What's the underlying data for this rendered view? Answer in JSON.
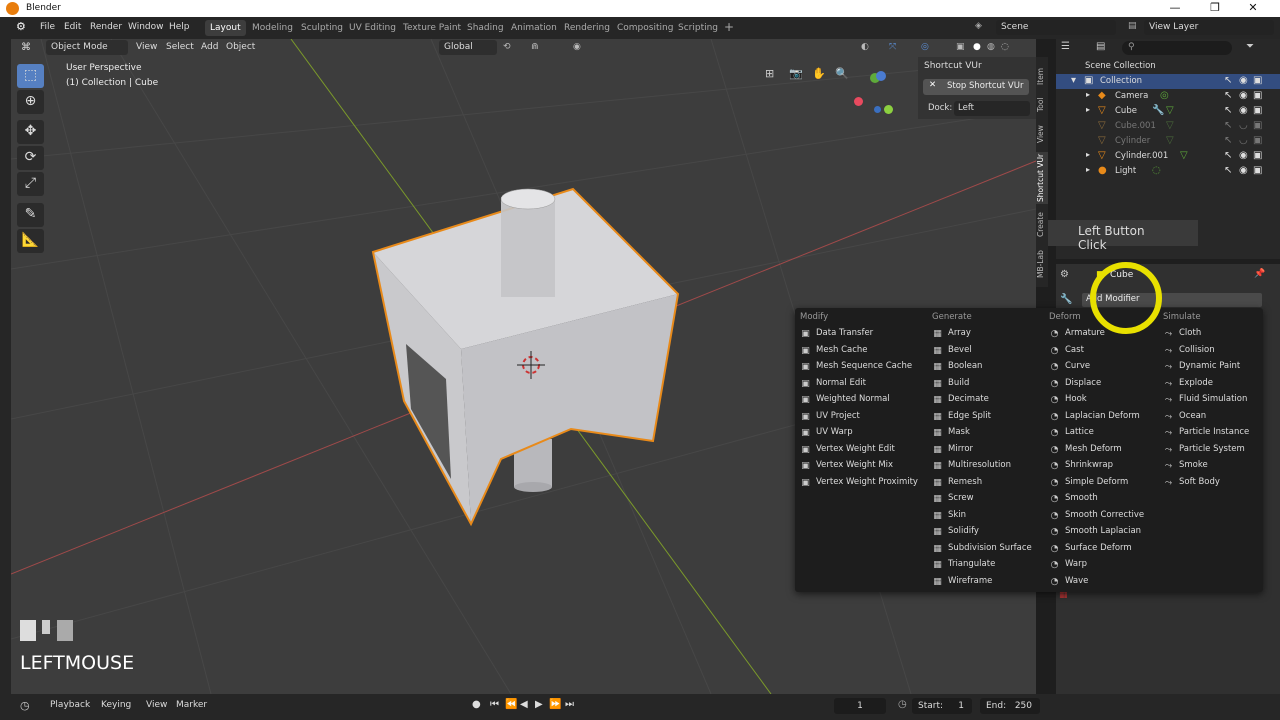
{
  "window": {
    "title": "Blender",
    "min_label": "—",
    "max_label": "❐",
    "close_label": "✕"
  },
  "menu": [
    "File",
    "Edit",
    "Render",
    "Window",
    "Help"
  ],
  "workspaces": [
    "Layout",
    "Modeling",
    "Sculpting",
    "UV Editing",
    "Texture Paint",
    "Shading",
    "Animation",
    "Rendering",
    "Compositing",
    "Scripting"
  ],
  "add_workspace": "+",
  "scene": {
    "label": "Scene",
    "view_layer": "View Layer"
  },
  "viewport": {
    "mode": "Object Mode",
    "menus": [
      "View",
      "Select",
      "Add",
      "Object"
    ],
    "transform": "Global",
    "overlay_line1": "User Perspective",
    "overlay_line2": "(1) Collection | Cube"
  },
  "npanel": {
    "title": "Shortcut VUr",
    "stop_button": "Stop Shortcut VUr",
    "dock_label": "Dock:",
    "dock_value": "Left"
  },
  "vtabs": [
    "Item",
    "Tool",
    "View",
    "Shortcut VUr",
    "Create",
    "MB-Lab"
  ],
  "outliner": {
    "root": "Scene Collection",
    "collection": "Collection",
    "items": [
      {
        "name": "Camera",
        "dim": false
      },
      {
        "name": "Cube",
        "dim": false
      },
      {
        "name": "Cube.001",
        "dim": true
      },
      {
        "name": "Cylinder",
        "dim": true
      },
      {
        "name": "Cylinder.001",
        "dim": false
      },
      {
        "name": "Light",
        "dim": false
      }
    ]
  },
  "left_click_label": "Left Button Click",
  "properties": {
    "object": "Cube",
    "add_modifier": "Add Modifier"
  },
  "modifier_menu": {
    "columns": [
      {
        "header": "Modify",
        "items": [
          "Data Transfer",
          "Mesh Cache",
          "Mesh Sequence Cache",
          "Normal Edit",
          "Weighted Normal",
          "UV Project",
          "UV Warp",
          "Vertex Weight Edit",
          "Vertex Weight Mix",
          "Vertex Weight Proximity"
        ]
      },
      {
        "header": "Generate",
        "items": [
          "Array",
          "Bevel",
          "Boolean",
          "Build",
          "Decimate",
          "Edge Split",
          "Mask",
          "Mirror",
          "Multiresolution",
          "Remesh",
          "Screw",
          "Skin",
          "Solidify",
          "Subdivision Surface",
          "Triangulate",
          "Wireframe"
        ]
      },
      {
        "header": "Deform",
        "items": [
          "Armature",
          "Cast",
          "Curve",
          "Displace",
          "Hook",
          "Laplacian Deform",
          "Lattice",
          "Mesh Deform",
          "Shrinkwrap",
          "Simple Deform",
          "Smooth",
          "Smooth Corrective",
          "Smooth Laplacian",
          "Surface Deform",
          "Warp",
          "Wave"
        ]
      },
      {
        "header": "Simulate",
        "items": [
          "Cloth",
          "Collision",
          "Dynamic Paint",
          "Explode",
          "Fluid Simulation",
          "Ocean",
          "Particle Instance",
          "Particle System",
          "Smoke",
          "Soft Body"
        ]
      }
    ]
  },
  "keypress": "LEFTMOUSE",
  "timeline": {
    "menus": [
      "Playback",
      "Keying",
      "View",
      "Marker"
    ],
    "frame": "1",
    "start_label": "Start:",
    "start": "1",
    "end_label": "End:",
    "end": "250"
  }
}
